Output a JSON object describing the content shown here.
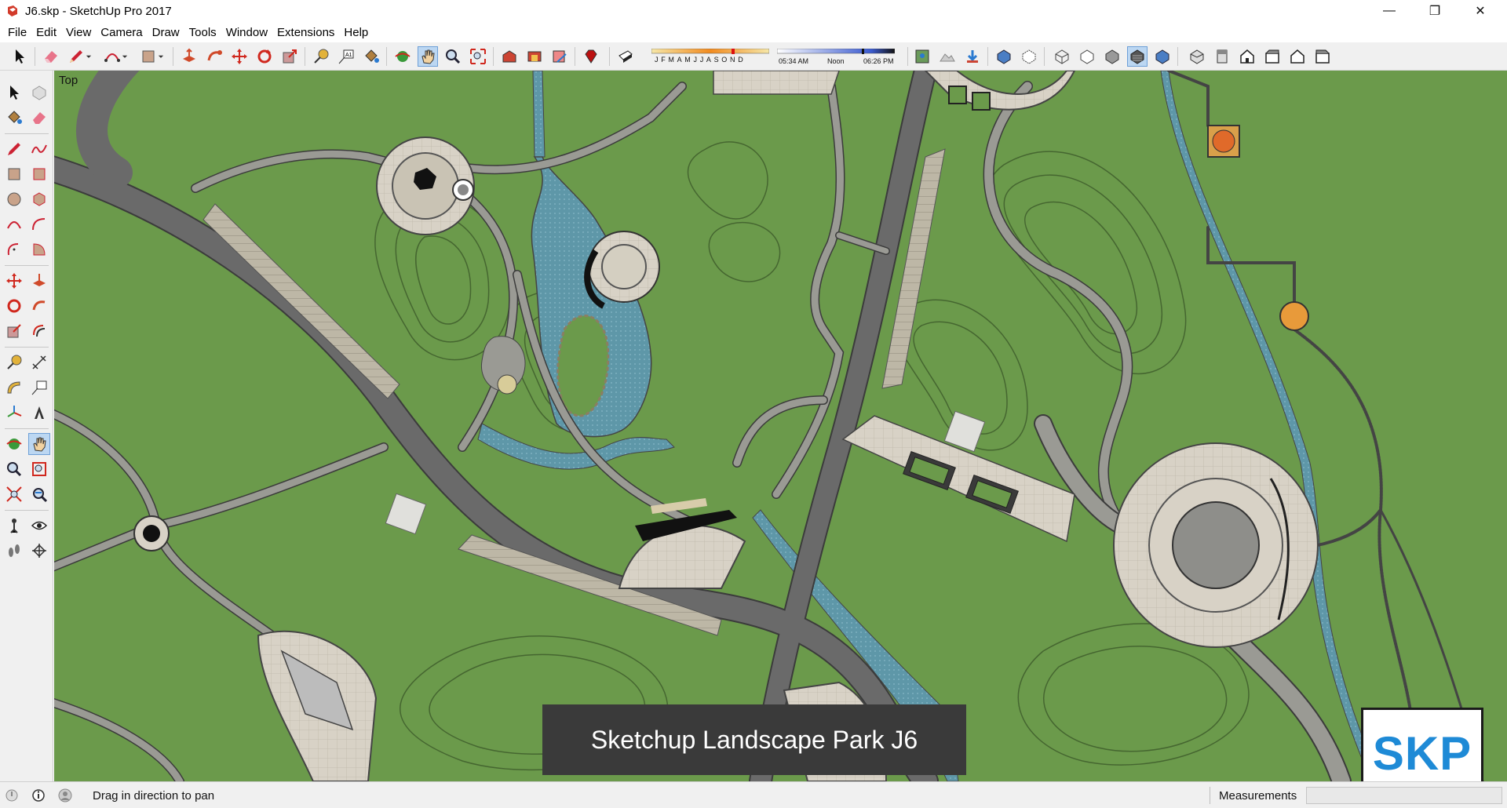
{
  "window": {
    "title": "J6.skp - SketchUp Pro 2017",
    "minimize_label": "—",
    "restore_label": "❐",
    "close_label": "✕"
  },
  "menu": [
    "File",
    "Edit",
    "View",
    "Camera",
    "Draw",
    "Tools",
    "Window",
    "Extensions",
    "Help"
  ],
  "shadows": {
    "months": "JFMAMJJASOND",
    "time_start": "05:34 AM",
    "time_mid": "Noon",
    "time_end": "06:26 PM"
  },
  "viewport": {
    "view_label": "Top",
    "caption": "Sketchup Landscape Park J6",
    "logo_text": "SKP"
  },
  "status": {
    "hint": "Drag in direction to pan",
    "measurements_label": "Measurements",
    "measurements_value": ""
  },
  "colors": {
    "grass": "#6b9a4b",
    "road": "#6a6a6a",
    "path": "#b7b5ae",
    "plaza": "#d8d2c6",
    "water": "#5e97a8",
    "accent_blue": "#1e8ad6"
  }
}
